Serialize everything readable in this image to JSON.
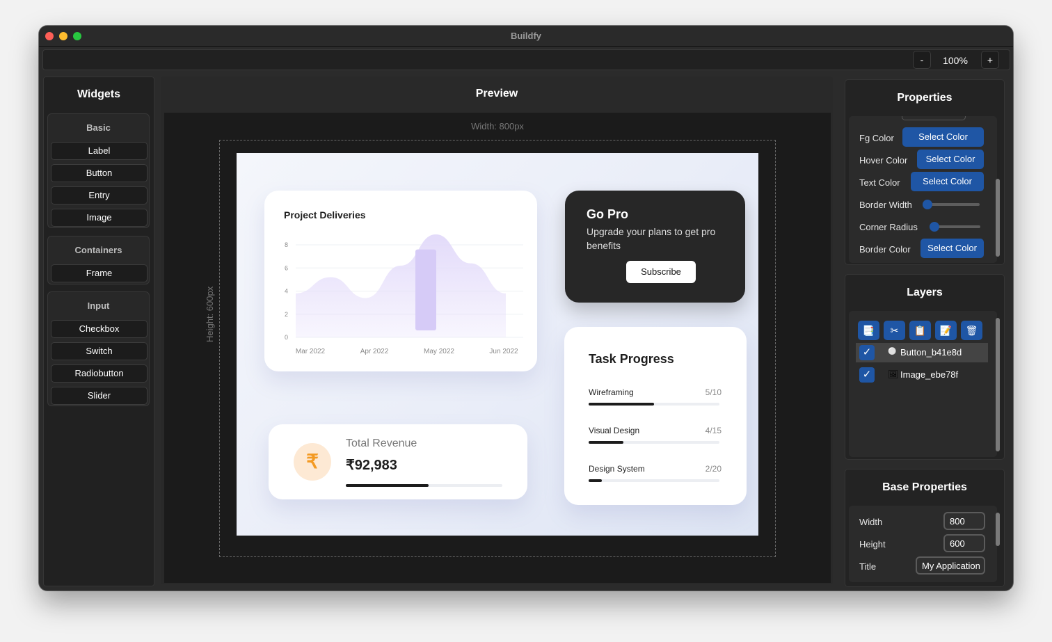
{
  "window": {
    "title": "Buildfy"
  },
  "toolbar": {
    "zoom_out": "-",
    "zoom_value": "100%",
    "zoom_in": "+"
  },
  "widgets": {
    "title": "Widgets",
    "groups": [
      {
        "title": "Basic",
        "items": [
          "Label",
          "Button",
          "Entry",
          "Image"
        ]
      },
      {
        "title": "Containers",
        "items": [
          "Frame"
        ]
      },
      {
        "title": "Input",
        "items": [
          "Checkbox",
          "Switch",
          "Radiobutton",
          "Slider"
        ]
      }
    ]
  },
  "preview": {
    "title": "Preview",
    "width_label": "Width: 800px",
    "height_label": "Height: 600px"
  },
  "app": {
    "deliveries": {
      "title": "Project Deliveries",
      "chart_data": {
        "type": "area",
        "x_labels": [
          "Mar 2022",
          "Apr 2022",
          "May 2022",
          "Jun 2022"
        ],
        "y_ticks": [
          "0",
          "2",
          "4",
          "6",
          "8"
        ],
        "ylim": [
          0,
          8
        ],
        "values": [
          3.8,
          5.2,
          3.4,
          6.2,
          8.9,
          6.4,
          3.8
        ],
        "bar": {
          "x_index": 2,
          "value": 7.6
        },
        "colors": {
          "area": "#e3dbfa",
          "bar": "#d6cbf7"
        },
        "grid": true
      }
    },
    "go_pro": {
      "title": "Go Pro",
      "description": "Upgrade your plans to get pro benefits",
      "button": "Subscribe"
    },
    "task_progress": {
      "title": "Task Progress",
      "tasks": [
        {
          "label": "Wireframing",
          "value": "5/10",
          "fraction": 0.5
        },
        {
          "label": "Visual Design",
          "value": "4/15",
          "fraction": 0.267
        },
        {
          "label": "Design System",
          "value": "2/20",
          "fraction": 0.1
        }
      ]
    },
    "revenue": {
      "icon": "₹",
      "label": "Total Revenue",
      "value": "₹92,983",
      "progress_fraction": 0.53
    }
  },
  "properties": {
    "title": "Properties",
    "rows": [
      {
        "label": "Fg Color",
        "button": "Select Color"
      },
      {
        "label": "Hover Color",
        "button": "Select Color"
      },
      {
        "label": "Text Color",
        "button": "Select Color"
      },
      {
        "label": "Border Width",
        "slider_value": 0
      },
      {
        "label": "Corner Radius",
        "slider_value": 0
      },
      {
        "label": "Border Color",
        "button": "Select Color"
      }
    ]
  },
  "layers": {
    "title": "Layers",
    "toolbar_icons": [
      "📑",
      "✂",
      "📋",
      "📝",
      "🗑"
    ],
    "items": [
      {
        "icon": "⚪",
        "name": "Button_b41e8d",
        "checked": true,
        "selected": true
      },
      {
        "icon": "🖼",
        "name": "Image_ebe78f",
        "checked": true,
        "selected": false
      }
    ]
  },
  "base_properties": {
    "title": "Base Properties",
    "width_label": "Width",
    "width_value": "800",
    "height_label": "Height",
    "height_value": "600",
    "title_label": "Title",
    "title_value": "My Application"
  },
  "colors": {
    "accent": "#1f56a5",
    "window_bg": "#2b2b2b"
  }
}
